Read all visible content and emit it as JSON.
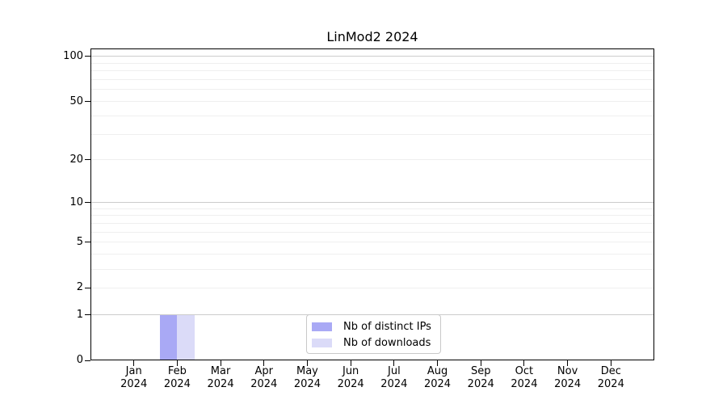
{
  "chart_data": {
    "type": "bar",
    "title": "LinMod2 2024",
    "categories": [
      "Jan",
      "Feb",
      "Mar",
      "Apr",
      "May",
      "Jun",
      "Jul",
      "Aug",
      "Sep",
      "Oct",
      "Nov",
      "Dec"
    ],
    "x_tick_line2": "2024",
    "series": [
      {
        "name": "Nb of distinct IPs",
        "color": "#a9a9f5",
        "values": [
          0,
          1,
          0,
          0,
          0,
          0,
          0,
          0,
          0,
          0,
          0,
          0
        ]
      },
      {
        "name": "Nb of downloads",
        "color": "#dbdbf8",
        "values": [
          0,
          1,
          0,
          0,
          0,
          0,
          0,
          0,
          0,
          0,
          0,
          0
        ]
      }
    ],
    "y_axis": {
      "scale": "log1p",
      "ylim": [
        0,
        113
      ],
      "ticks": [
        0,
        1,
        2,
        5,
        10,
        20,
        50,
        100
      ],
      "major_gridlines": [
        1,
        10,
        100
      ],
      "minor_gridlines": [
        2,
        3,
        4,
        5,
        6,
        7,
        8,
        9,
        20,
        30,
        40,
        50,
        60,
        70,
        80,
        90
      ]
    },
    "legend": {
      "position": "lower center"
    },
    "colors": {
      "major_grid": "#cccccc",
      "minor_grid": "#efefef",
      "frame": "#000000",
      "legend_border": "#c9c9c9",
      "background": "#ffffff"
    },
    "grid": true
  }
}
